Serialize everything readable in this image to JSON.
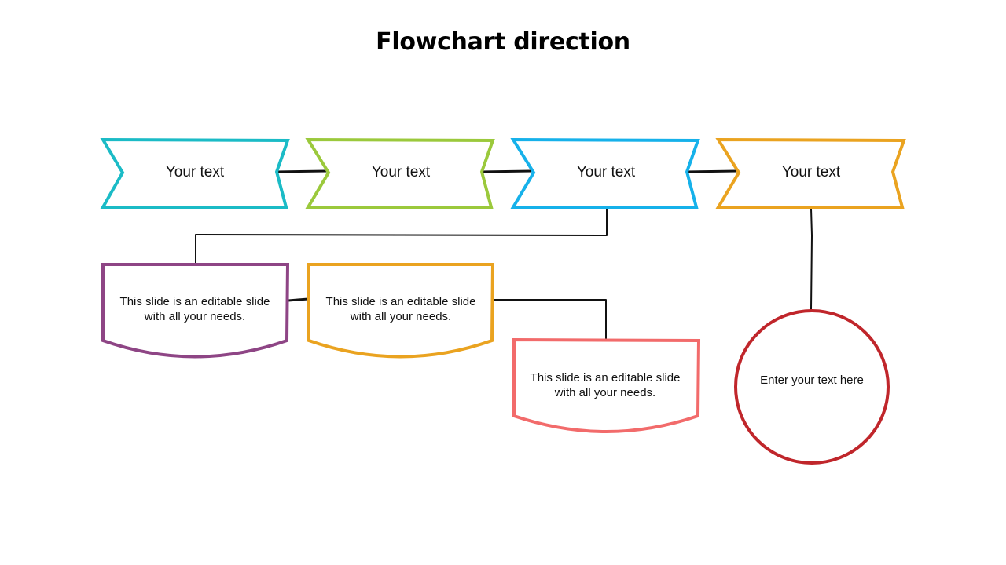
{
  "title": "Flowchart direction",
  "steps": [
    {
      "label": "Your text",
      "color": "#1BBBC6"
    },
    {
      "label": "Your text",
      "color": "#9BC93C"
    },
    {
      "label": "Your text",
      "color": "#16B1EA"
    },
    {
      "label": "Your text",
      "color": "#EAA320"
    }
  ],
  "boxes": [
    {
      "text": "This slide is an editable slide with all your needs.",
      "color": "#8E4585"
    },
    {
      "text": "This slide is an editable slide with all your needs.",
      "color": "#EAA320"
    },
    {
      "text": "This slide is an editable slide with all your needs.",
      "color": "#F26B6B"
    }
  ],
  "circle": {
    "text": "Enter your text here",
    "color": "#C0262B"
  },
  "connector_color": "#111111"
}
